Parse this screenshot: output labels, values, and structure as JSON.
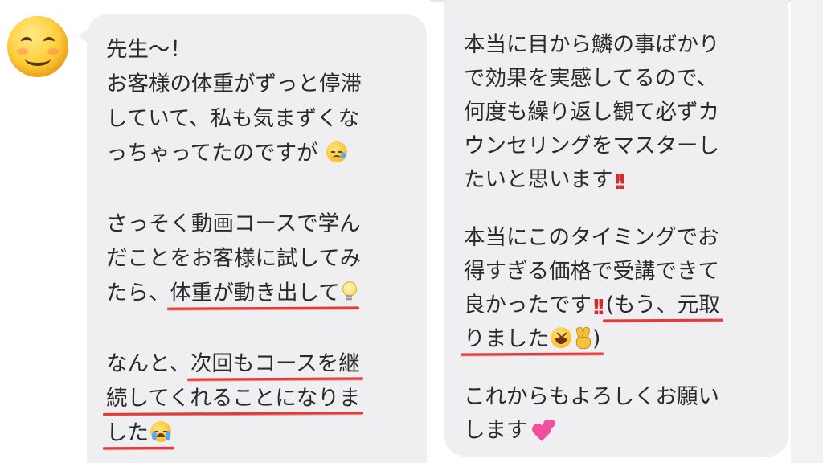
{
  "left_message": {
    "avatar": "smiling-face-emoji",
    "lines": [
      {
        "text": "先生〜！"
      },
      {
        "text": "お客様の体重がずっと停滞"
      },
      {
        "text": "していて、私も気まずくな"
      },
      {
        "text": "っちゃってたのですが",
        "emoji": "crying-face-emoji"
      },
      {
        "text": ""
      },
      {
        "text": "さっそく動画コースで学ん"
      },
      {
        "text": "だことをお客様に試してみ"
      },
      {
        "pre": "たら、",
        "highlight": "体重が動き出して",
        "emoji": "light-bulb-emoji"
      },
      {
        "text": ""
      },
      {
        "pre": "なんと、",
        "highlight": "次回もコースを継"
      },
      {
        "highlight": "続してくれることになりま"
      },
      {
        "highlight": "した",
        "emoji": "loudly-crying-face-emoji"
      }
    ]
  },
  "right_message": {
    "lines": [
      {
        "text": "本当に目から鱗の事ばかり"
      },
      {
        "text": "で効果を実感してるので、"
      },
      {
        "text": "何度も繰り返し観て必ずカ"
      },
      {
        "text": "ウンセリングをマスターし"
      },
      {
        "text": "たいと思います",
        "emoji": "double-exclamation-emoji"
      },
      {
        "text": ""
      },
      {
        "text": "本当にこのタイミングでお"
      },
      {
        "text": "得すぎる価格で受講できて"
      },
      {
        "pre": "良かったです",
        "mid_emoji": "double-exclamation-emoji",
        "highlight": "(もう、元取"
      },
      {
        "highlight": "りました",
        "emoji": "grinning-squinting-face-emoji",
        "emoji2": "victory-hand-emoji",
        "post": ")"
      },
      {
        "text": ""
      },
      {
        "text": "これからもよろしくお願い"
      },
      {
        "text": "します",
        "emoji": "two-hearts-emoji"
      }
    ]
  },
  "colors": {
    "bubble_bg": "#efeff2",
    "text": "#2a2a2a",
    "underline": "#e23b3b",
    "exclamation": "#d42a2a"
  }
}
